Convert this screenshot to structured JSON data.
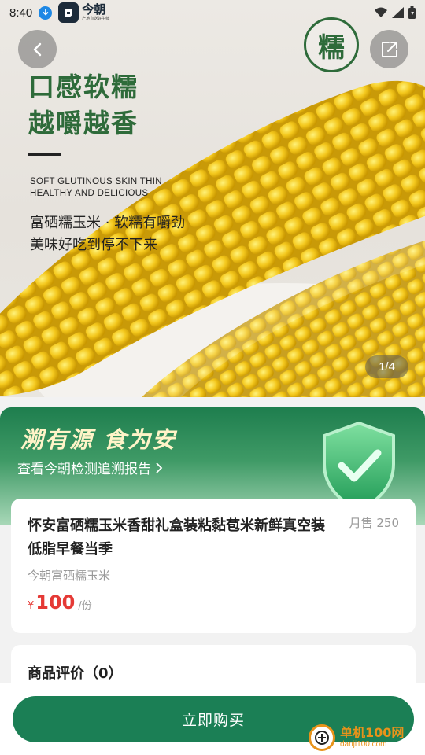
{
  "status_bar": {
    "time": "8:40"
  },
  "brand": {
    "name": "今朝",
    "subtitle": "产地直送好生鲜"
  },
  "hero": {
    "seal_char": "糯",
    "headline_lines": [
      "口感软糯",
      "越嚼越香"
    ],
    "english_lines": [
      "SOFT GLUTINOUS SKIN THIN",
      "HEALTHY AND DELICIOUS"
    ],
    "chinese_lines": [
      "富硒糯玉米 · 软糯有嚼劲",
      "美味好吃到停不下来"
    ],
    "page_indicator": "1/4"
  },
  "trace": {
    "title": "溯有源 食为安",
    "link_text": "查看今朝检测追溯报告"
  },
  "product": {
    "title": "怀安富硒糯玉米香甜礼盒装粘黏苞米新鲜真空装低脂早餐当季",
    "monthly_sales": "月售 250",
    "subtitle": "今朝富硒糯玉米",
    "currency": "¥",
    "price": "100",
    "unit": "/份"
  },
  "reviews": {
    "title": "商品评价（0）"
  },
  "actions": {
    "buy_label": "立即购买"
  },
  "watermark": {
    "main": "单机100网",
    "sub": "danji100.com"
  },
  "colors": {
    "primary_green": "#1b7f55",
    "price_red": "#e53935",
    "brand_dark_green": "#2e6b3a"
  }
}
